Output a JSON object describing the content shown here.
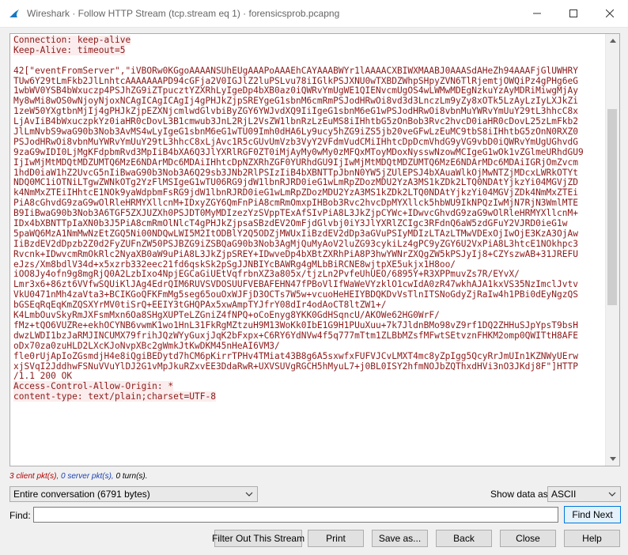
{
  "window": {
    "title": "Wireshark · Follow HTTP Stream (tcp.stream eq 1) · forensicsprob.pcapng"
  },
  "stream_lines": [
    {
      "text": "Connection: keep-alive",
      "hl": true
    },
    {
      "text": "Keep-Alive: timeout=5",
      "hl": true
    },
    {
      "text": "",
      "hl": false
    },
    {
      "text": "42[\"eventFromServer\",\"iVBORw0KGgoAAAANSUhEUgAAAPoAAAEhCAYAAABWYr1lAAAACXBIWXMAABJ0AAASdAHeZh94AAAFjGlUWHRY",
      "hl": false
    },
    {
      "text": "TUw6Y29tLmFkb2JlLnhtcAAAAAAAPD94cGFja2V0IGJlZ2luPSLvu78iIGlkPSJXNU0wTXBDZWhpSHpyZVN6TlRjemtjOWQiPz4gPHg6eG",
      "hl": false
    },
    {
      "text": "1wbWV0YSB4bWxuczp4PSJhZG9iZTpucztYZXRhLyIgeDp4bXB0az0iQWRvYmUgWE1QIENvcmUgOS4wLWMwMDEgNzkuYzAyMDRiMiwgMjAy",
      "hl": false
    },
    {
      "text": "My8wMi8wOS0wNjoyNjoxNCAgICAgICAgIj4gPHJkZjpSREYgeG1sbnM6cmRmPSJodHRwOi8vd3d3LnczLm9yZy8xOTk5LzAyLzIyLXJkZi",
      "hl": false
    },
    {
      "text": "1zeW50YXgtbnMjIj4gPHJkZjpEZXNjcmlwdGlvbiByZGY6YWJvdXQ9IiIgeG1sbnM6eG1wPSJodHRwOi8vbnMuYWRvYmUuY29tL3hhcC8x",
      "hl": false
    },
    {
      "text": "LjAvIiB4bWxuczpkYz0iaHR0cDovL3B1cmwub3JnL2RjL2VsZW1lbnRzLzEuMS8iIHhtbG5zOnBob3Rvc2hvcD0iaHR0cDovL25zLmFkb2",
      "hl": false
    },
    {
      "text": "JlLmNvbS9waG90b3Nob3AvMS4wLyIgeG1sbnM6eG1wTU09Imh0dHA6Ly9ucy5hZG9iZS5jb20veGFwLzEuMC9tbS8iIHhtbG5zOnN0RXZ0",
      "hl": false
    },
    {
      "text": "PSJodHRwOi8vbnMuYWRvYmUuY29tL3hhcC8xLjAvc1R5cGUvUmVzb3VyY2VFdmVudCMiIHhtcDpDcmVhdG9yVG9vbD0iQWRvYmUgUGhvdG",
      "hl": false
    },
    {
      "text": "9zaG9wIDI0LjMgKFdpbmRvd3MpIiB4bXA6Q3JlYXRlRGF0ZT0iMjAyMy0wMy0zMFQxMToyMDoxNysswNzowMCIgeG1wOk1vZGlmeURhdGU9",
      "hl": false
    },
    {
      "text": "IjIwMjMtMDQtMDZUMTQ6MzE6NDArMDc6MDAiIHhtcDpNZXRhZGF0YURhdGU9IjIwMjMtMDQtMDZUMTQ6MzE6NDArMDc6MDAiIGRjOmZvcm",
      "hl": false
    },
    {
      "text": "1hdD0iaW1hZ2UvcG5nIiBwaG90b3Nob3A6Q29sb3JNb2RlPSIzIiB4bXBNTTpJbnN0YW5jZUlEPSJ4bXAuaWlkOjMwNTZjMDcxLWRkOTYt",
      "hl": false
    },
    {
      "text": "NDQ0MC1iOTNiLTgwZWNkOTg2YzFlMSIgeG1wTU06RG9jdW1lbnRJRD0ieG1wLmRpZDozMDU2YzA3MS1kZDk2LTQ0NDAtYjkzYi04MGVjZD",
      "hl": false
    },
    {
      "text": "k4NmMxZTEiIHhtcE1NOk9yaWdpbmFsRG9jdW1lbnRJRD0ieG1wLmRpZDozMDU2YzA3MS1kZDk2LTQ0NDAtYjkzYi04MGVjZDk4NmMxZTEi",
      "hl": false
    },
    {
      "text": "PiA8cGhvdG9zaG9wOlRleHRMYXllcnM+IDxyZGY6QmFnPiA8cmRmOmxpIHBob3Rvc2hvcDpMYXllck5hbWU9IkNPQzIwMjN7RjN3WmlMTE",
      "hl": false
    },
    {
      "text": "B9IiBwaG90b3Nob3A6TGF5ZXJUZXh0PSJDT0MyMDIzezYzSVppTExAfSIvPiA8L3JkZjpCYWc+IDwvcGhvdG9zaG9wOlRleHRMYXllcnM+",
      "hl": false
    },
    {
      "text": "IDx4bXBNTTpIaXN0b3J5PiA8cmRmOlNlcT4gPHJkZjpsaSBzdEV2OmFjdGlvbj0iY3JlYXRlZCIgc3RFdnQ6aW5zdGFuY2VJRD0ieG1w",
      "hl": false
    },
    {
      "text": "5paWQ6MzA1NmMwNzEtZGQ5Ni00NDQwLWI5M2ItODBlY2Q5ODZjMWUxIiBzdEV2dDp3aGVuPSIyMDIzLTAzLTMwVDExOjIwOjE3KzA3OjAw",
      "hl": false
    },
    {
      "text": "IiBzdEV2dDpzb2Z0d2FyZUFnZW50PSJBZG9iZSBQaG90b3Nob3AgMjQuMyAoV2luZG93cykiLz4gPC9yZGY6U2VxPiA8L3htcE1NOkhpc3",
      "hl": false
    },
    {
      "text": "Rvcnk+IDwvcmRmOkRlc2NyaXB0aW9uPiA8L3JkZjpSREY+IDwveDp4bXBtZXRhPiA8P3hwYWNrZXQgZW5kPSJyIj8+CZYszwAB+31JREFU",
      "hl": false
    },
    {
      "text": "eJzs/Xm8bdlV34d+x5xzrb332eec21fd6qskSk2pSgJJNBIYcBAWRg4gMLbBiRCNE8wjtpXE5ukjx1H8oo/",
      "hl": false
    },
    {
      "text": "iOO8Jy4ofn9g8mgRjQ0A2LzbIxo4NpjEGCaGiUEtVqfrbnXZ3a805x/tjzLn2PvfeUhUEO/6895Y+R3XPPmuvZs7R/EYvX/",
      "hl": false
    },
    {
      "text": "Lmr3x6+86zt6VVfwSQUiKlJAg4EdrQIM6RUVSVDOSUUFVEBAFEHN47fPBoVlIfWaWeVYzklO1cwIdA0zR47wkhAJA1kxVS35NzImclJvtv",
      "hl": false
    },
    {
      "text": "VkU0471nMh4zaVta3+BCIKGoQFKFmMg5seg65ouOxWJFjD3OCTs7W5w+vcuoHeHEIYBDQKDvVsTlnITSNoGdyZjRaIw4h1PBi0dEyNgzQS",
      "hl": false
    },
    {
      "text": "bGSEqRqEqKmZQSXYrMV0tiSrQ+EEIY3tGHQPAx5xwAmpTYJfrY08dIr4odAoCT8ltZW1+/",
      "hl": false
    },
    {
      "text": "K4LmbOuvSkyRmJXFsmMxn6Oa8SHgXUPTeLZGniZ4fNPQ+oCoEnyg8YKK0GdHSqncU/AKOWe62HG0WrF/",
      "hl": false
    },
    {
      "text": "fMz+tQO6VUZRe+ekhOCYNB6vwmK1wo1HnL31FkRgMZtzuH9M13WoKk0IbE1G9H1PUuXuu+7k7JldnBMo98vZ9rf1DQ2ZHHuSJpYpsT9bsH",
      "hl": false
    },
    {
      "text": "dwzLWDI1bzJaRMJINCUMX79frihJQzWYyGuxjJqK2bFxpx+C6RY6YdNVw4f5q777mTtm1ZLBbMZsfMFwtSEtvznFHKM2omp0QWITtH8AFE",
      "hl": false
    },
    {
      "text": "oDx70za0zuHLD2LXcKJoNvpXBc2gWmkJtKwDKM45nHeAI6VM3/",
      "hl": false
    },
    {
      "text": "fle0rUjApIoZGsmdjH4e8iQgiBEDytd7hCM6pKirrTPHv4TMiat43B8g6A5sxwfxFUFVJCvLMXT4mc8yZpIgg5QcyRrJmUIn1KZNWyUErw",
      "hl": false
    },
    {
      "text": "xjSVqI2JddhwFSNuVVuYlDJ2G1vMpJkuRZxvEE3DdaRwR+UXVSUVgRGCH5hMyuL7+j0BL0ISY2hfmNOJbZQThxdHVi3nO3JKdj8F\"]HTTP",
      "hl": false
    },
    {
      "text": "/1.1 200 OK",
      "hl": false
    },
    {
      "text": "Access-Control-Allow-Origin: *",
      "hl": true
    },
    {
      "text": "content-type: text/plain;charset=UTF-8",
      "hl": true
    }
  ],
  "status": {
    "client_pkts": "3 client pkt(s),",
    "server_pkts": "0 server pkt(s),",
    "turns": "0 turn(s)."
  },
  "controls": {
    "conversation_select": "Entire conversation (6791 bytes)",
    "show_data_label": "Show data as",
    "show_data_select": "ASCII",
    "find_label": "Find:",
    "find_value": "",
    "find_next": "Find Next"
  },
  "buttons": {
    "filter_out": "Filter Out This Stream",
    "print": "Print",
    "save_as": "Save as...",
    "back": "Back",
    "close": "Close",
    "help": "Help"
  },
  "colors": {
    "client_text": "#8b1a1a",
    "client_highlight": "#fbeded",
    "accent": "#0078d7"
  }
}
